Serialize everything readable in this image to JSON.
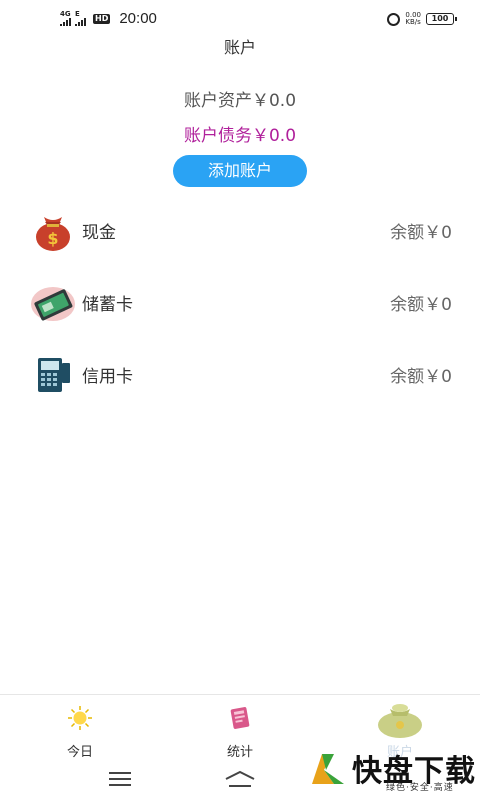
{
  "status_bar": {
    "network_1": "4G",
    "network_2": "E",
    "hd": "HD",
    "time": "20:00",
    "net_speed": "0.00",
    "net_speed_unit": "KB/s",
    "battery": "100"
  },
  "header": {
    "title": "账户"
  },
  "summary": {
    "assets": "账户资产￥0.0",
    "debts": "账户债务￥0.0",
    "add_button": "添加账户"
  },
  "accounts": [
    {
      "name": "现金",
      "balance": "余额￥0",
      "icon": "money-bag-icon"
    },
    {
      "name": "储蓄卡",
      "balance": "余额￥0",
      "icon": "debit-card-icon"
    },
    {
      "name": "信用卡",
      "balance": "余额￥0",
      "icon": "pos-terminal-icon"
    }
  ],
  "tabs": [
    {
      "label": "今日",
      "icon": "sun-icon"
    },
    {
      "label": "统计",
      "icon": "notebook-icon"
    },
    {
      "label": "账户",
      "icon": "money-bag-icon",
      "active": true
    }
  ],
  "watermark": {
    "title": "快盘下载",
    "subtitle": "绿色·安全·高速"
  },
  "colors": {
    "accent": "#2aa3f4",
    "debt": "#b0209b"
  }
}
